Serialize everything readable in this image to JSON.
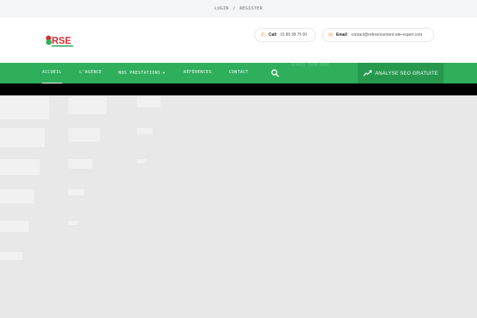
{
  "topbar": {
    "login": "LOGIN",
    "separator": "/",
    "register": "REGISTER"
  },
  "header": {
    "logo_text": "RSE",
    "call": {
      "label": "Call:",
      "value": "01 85 08 75 00",
      "icon": "phone-icon"
    },
    "email": {
      "label": "Email:",
      "value": "contact@referencement-site-expert.com",
      "icon": "envelope-icon"
    }
  },
  "nav": {
    "items": [
      {
        "label": "ACCUEIL"
      },
      {
        "label": "L'AGENCE"
      },
      {
        "label": "NOS PRESTATIONS"
      },
      {
        "label": "RÉFÉRENCES"
      },
      {
        "label": "CONTACT"
      }
    ],
    "search_hint": "SEARCH FROM HERE",
    "cta_label": "ANALYSE SEO GRATUITE"
  },
  "colors": {
    "brand_green": "#2fae5c",
    "cta_green": "#27994f",
    "logo_red": "#d8292f",
    "accent_orange": "#e8a75e"
  }
}
